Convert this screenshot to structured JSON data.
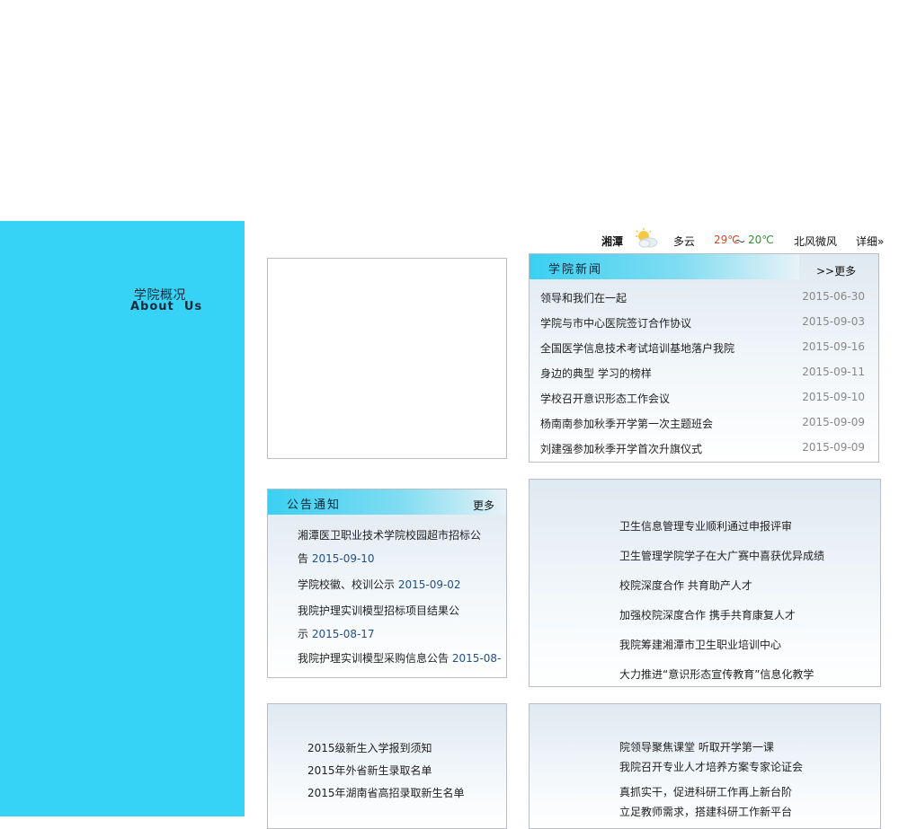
{
  "sidebar": {
    "title_cn": "学院概况",
    "title_en": "About  Us"
  },
  "weather": {
    "city": "湘潭",
    "icon": "partly-cloudy-icon",
    "condition": "多云",
    "high": "29℃",
    "tilde": "～",
    "low": "20℃",
    "wind": "北风微风",
    "detail": "详细»"
  },
  "news": {
    "title": "学院新闻",
    "more": ">>更多",
    "items": [
      {
        "text": "领导和我们在一起",
        "date": "2015-06-30"
      },
      {
        "text": "学院与市中心医院签订合作协议",
        "date": "2015-09-03"
      },
      {
        "text": "全国医学信息技术考试培训基地落户我院",
        "date": "2015-09-16"
      },
      {
        "text": "身边的典型 学习的榜样",
        "date": "2015-09-11"
      },
      {
        "text": "学校召开意识形态工作会议",
        "date": "2015-09-10"
      },
      {
        "text": "杨南南参加秋季开学第一次主题班会",
        "date": "2015-09-09"
      },
      {
        "text": "刘建强参加秋季开学首次升旗仪式",
        "date": "2015-09-09"
      }
    ]
  },
  "notice": {
    "title": "公告通知",
    "more": "更多",
    "lines": [
      {
        "text": "湘潭医卫职业技术学院校园超市招标公",
        "date": ""
      },
      {
        "text": "告 ",
        "date": "2015-09-10"
      },
      {
        "text": "学院校徽、校训公示 ",
        "date": "2015-09-02"
      },
      {
        "text": "我院护理实训模型招标项目结果公",
        "date": ""
      },
      {
        "text": "示 ",
        "date": "2015-08-17"
      },
      {
        "text": "我院护理实训模型采购信息公告 ",
        "date": "2015-08-"
      }
    ]
  },
  "list_mid_right": [
    "卫生信息管理专业顺利通过申报评审",
    "卫生管理学院学子在大广赛中喜获优异成绩",
    "校院深度合作 共育助产人才",
    "加强校院深度合作 携手共育康复人才",
    "我院筹建湘潭市卫生职业培训中心",
    "大力推进“意识形态宣传教育”信息化教学"
  ],
  "list_bottom_left": [
    "2015级新生入学报到须知",
    "2015年外省新生录取名单",
    "2015年湖南省高招录取新生名单"
  ],
  "list_bottom_right": [
    "院领导聚焦课堂 听取开学第一课",
    "我院召开专业人才培养方案专家论证会",
    "真抓实干，促进科研工作再上新台阶",
    "立足教师需求，搭建科研工作新平台"
  ]
}
